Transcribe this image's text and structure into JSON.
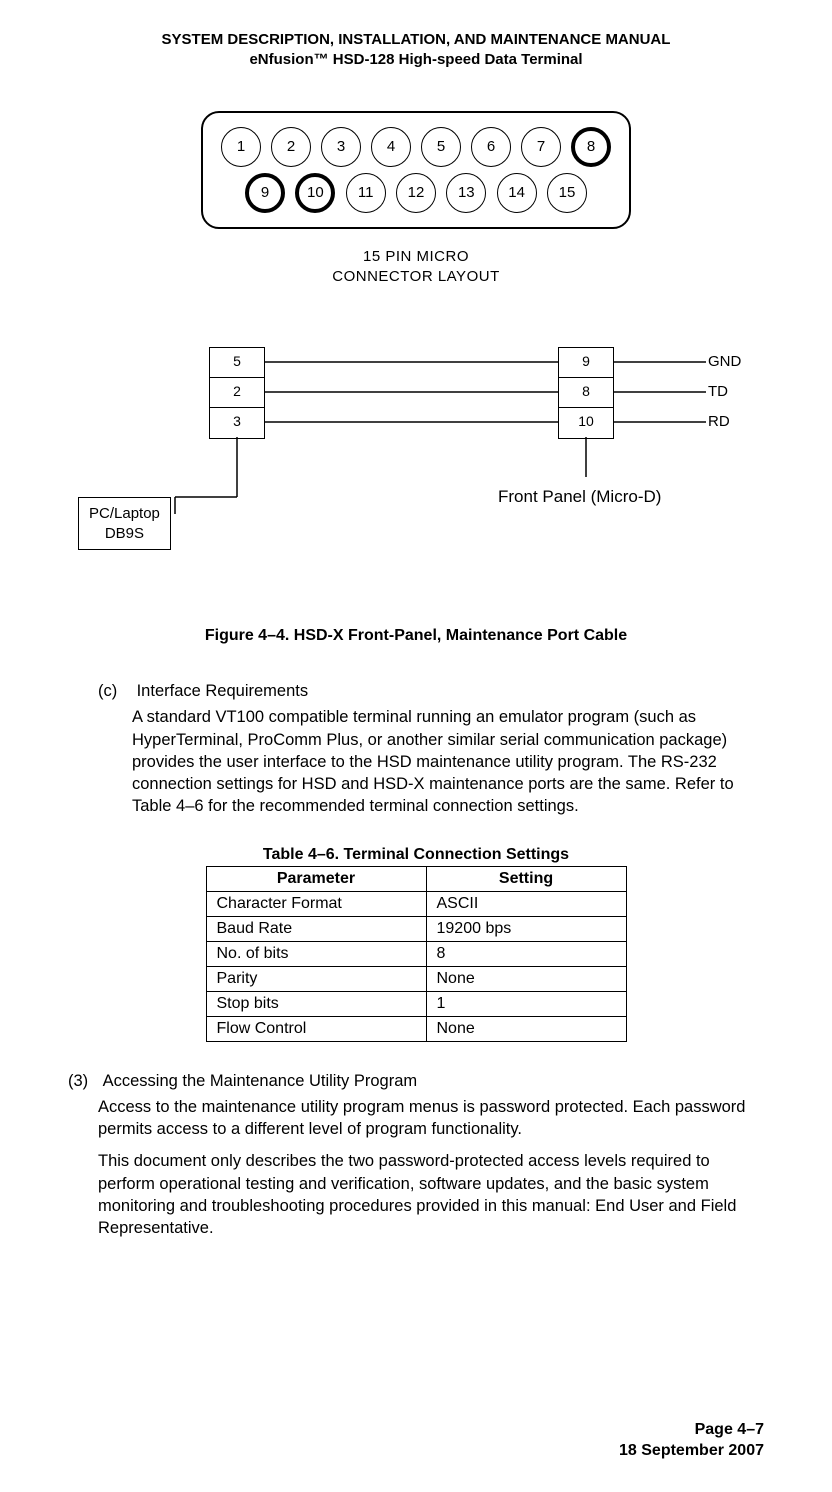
{
  "header": {
    "line1": "SYSTEM DESCRIPTION, INSTALLATION, AND MAINTENANCE MANUAL",
    "line2": "eNfusion™ HSD-128 High-speed Data Terminal"
  },
  "connector": {
    "top_pins": [
      "1",
      "2",
      "3",
      "4",
      "5",
      "6",
      "7",
      "8"
    ],
    "bottom_pins": [
      "9",
      "10",
      "11",
      "12",
      "13",
      "14",
      "15"
    ],
    "bold_pins": [
      "8",
      "9",
      "10"
    ],
    "label_line1": "15 PIN MICRO",
    "label_line2": "CONNECTOR LAYOUT"
  },
  "wiring": {
    "left_pins": [
      "5",
      "2",
      "3"
    ],
    "right_pins": [
      "9",
      "8",
      "10"
    ],
    "signals": [
      "GND",
      "TD",
      "RD"
    ],
    "pc_label_line1": "PC/Laptop",
    "pc_label_line2": "DB9S",
    "front_panel": "Front Panel (Micro-D)"
  },
  "figure_caption": "Figure 4–4. HSD-X Front-Panel, Maintenance Port Cable",
  "section_c": {
    "letter": "(c)",
    "title": "Interface Requirements",
    "body": "A standard VT100 compatible terminal running an emulator program (such as HyperTerminal, ProComm Plus, or another similar serial communication package) provides the user interface to the HSD maintenance utility program. The RS-232 connection settings for HSD and HSD-X maintenance ports are the same. Refer to Table 4–6 for the recommended terminal connection settings."
  },
  "table": {
    "caption": "Table 4–6. Terminal Connection Settings",
    "head_param": "Parameter",
    "head_setting": "Setting",
    "rows": [
      {
        "param": "Character Format",
        "setting": "ASCII"
      },
      {
        "param": "Baud Rate",
        "setting": "19200 bps"
      },
      {
        "param": "No. of bits",
        "setting": "8"
      },
      {
        "param": "Parity",
        "setting": "None"
      },
      {
        "param": "Stop bits",
        "setting": "1"
      },
      {
        "param": "Flow Control",
        "setting": "None"
      }
    ]
  },
  "section_3": {
    "number": "(3)",
    "title": "Accessing the Maintenance Utility Program",
    "p1": "Access to the maintenance utility program menus is password protected. Each password permits access to a different level of program functionality.",
    "p2": "This document only describes the two password-protected access levels required to perform operational testing and verification, software updates, and the basic system monitoring and troubleshooting procedures provided in this manual: End User and Field Representative."
  },
  "footer": {
    "page": "Page 4–7",
    "date": "18 September 2007"
  }
}
